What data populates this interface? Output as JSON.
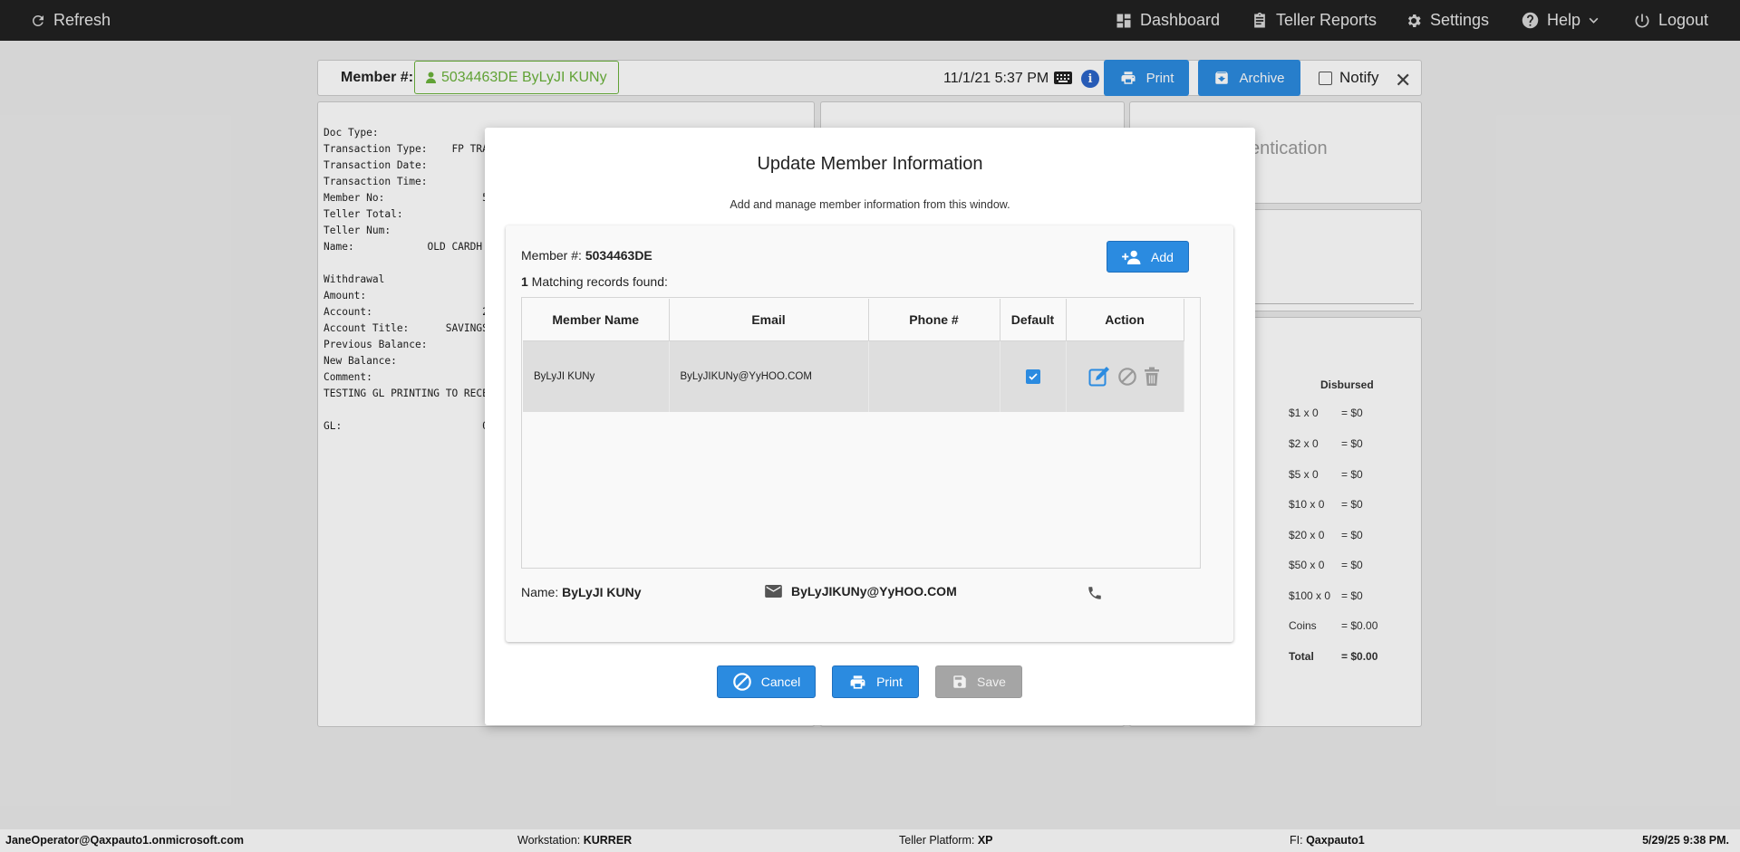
{
  "nav": {
    "refresh": "Refresh",
    "dashboard": "Dashboard",
    "teller_reports": "Teller Reports",
    "settings": "Settings",
    "help": "Help",
    "logout": "Logout"
  },
  "member_bar": {
    "label": "Member #:",
    "member": "5034463DE ByLyJI KUNy",
    "datetime": "11/1/21 5:37 PM",
    "print_label": "Print",
    "archive_label": "Archive",
    "notify_label": "Notify",
    "close_glyph": "✕"
  },
  "receipt": {
    "lines": "Doc Type:\nTransaction Type:    FP TRA\nTransaction Date:\nTransaction Time:\nMember No:                5\nTeller Total:\nTeller Num:\nName:            OLD CARDH\n\nWithdrawal\nAmount:\nAccount:                  2\nAccount Title:      SAVINGS\nPrevious Balance:\nNew Balance:\nComment:\nTESTING GL PRINTING TO RECE\n\nGL:                       0"
  },
  "auth_panel": {
    "partial_title": "entication"
  },
  "cash": {
    "header": "Disbursed",
    "rows": [
      {
        "denom": "$1 x 0",
        "amt": "= $0"
      },
      {
        "denom": "$2 x 0",
        "amt": "= $0"
      },
      {
        "denom": "$5 x 0",
        "amt": "= $0"
      },
      {
        "denom": "$10 x 0",
        "amt": "= $0"
      },
      {
        "denom": "$20 x 0",
        "amt": "= $0"
      },
      {
        "denom": "$50 x 0",
        "amt": "= $0"
      },
      {
        "denom": "$100 x 0",
        "amt": "= $0"
      },
      {
        "denom": "Coins",
        "amt": "= $0.00"
      },
      {
        "denom": "Total",
        "amt": "= $0.00"
      }
    ]
  },
  "modal": {
    "title": "Update Member Information",
    "subtitle": "Add and manage member information from this window.",
    "member_label": "Member #: ",
    "member_value": "5034463DE",
    "found_count": "1",
    "found_text": " Matching records found:",
    "add_label": "Add",
    "table": {
      "headers": [
        "Member Name",
        "Email",
        "Phone #",
        "Default",
        "Action"
      ],
      "rows": [
        {
          "name": "ByLyJI KUNy",
          "email": "ByLyJIKUNy@YyHOO.COM",
          "phone": "",
          "default": true
        }
      ]
    },
    "name_label": "Name: ",
    "name_value": "ByLyJI KUNy",
    "email_value": "ByLyJIKUNy@YyHOO.COM",
    "cancel_label": "Cancel",
    "print_label": "Print",
    "save_label": "Save"
  },
  "status": {
    "user": "JaneOperator@Qaxpauto1.onmicrosoft.com",
    "workstation_label": "Workstation: ",
    "workstation": "KURRER",
    "platform_label": "Teller Platform: ",
    "platform": "XP",
    "fi_label": "FI: ",
    "fi": "Qaxpauto1",
    "datetime": "5/29/25 9:38 PM."
  },
  "colors": {
    "primary": "#2b8be0",
    "member_green": "#6bb33c",
    "topbar": "#212121"
  }
}
